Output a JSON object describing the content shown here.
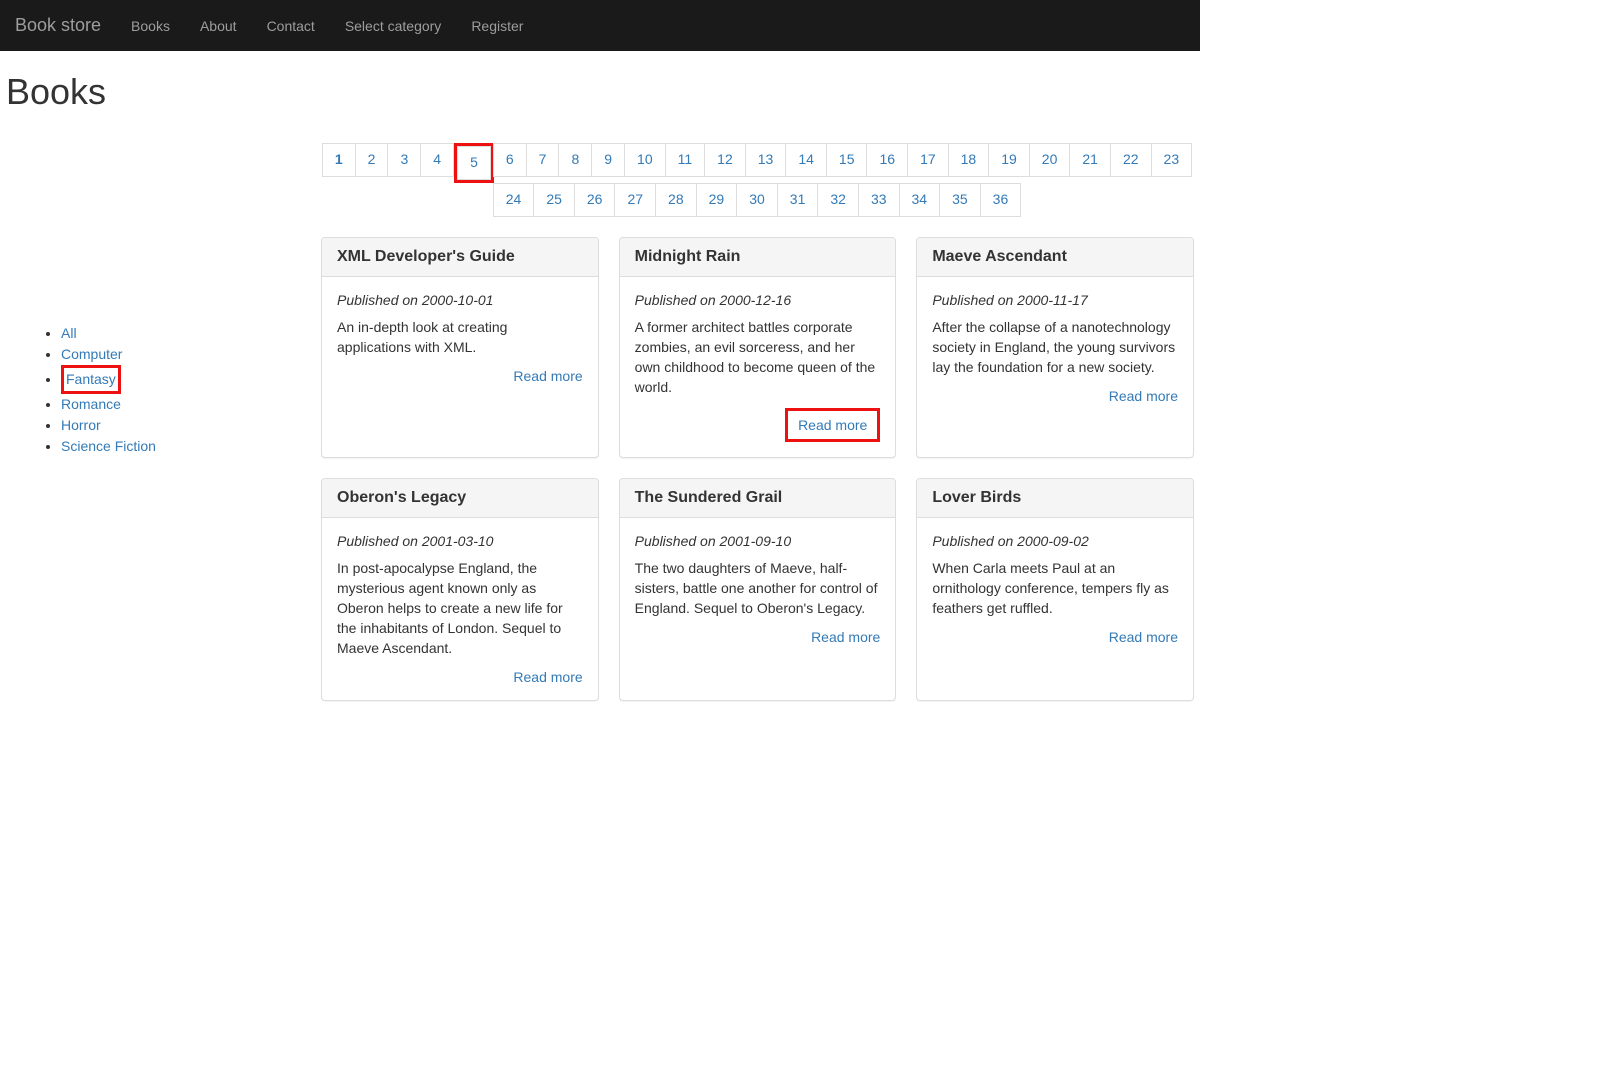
{
  "nav": {
    "brand": "Book store",
    "items": [
      "Books",
      "About",
      "Contact",
      "Select category",
      "Register"
    ]
  },
  "page_title": "Books",
  "pagination": {
    "total": 36,
    "active": 1,
    "highlighted": 5
  },
  "categories": {
    "items": [
      "All",
      "Computer",
      "Fantasy",
      "Romance",
      "Horror",
      "Science Fiction"
    ],
    "highlighted": "Fantasy"
  },
  "read_more_label": "Read more",
  "published_prefix": "Published on ",
  "books": [
    {
      "title": "XML Developer's Guide",
      "date": "2000-10-01",
      "desc": "An in-depth look at creating applications with XML.",
      "hl_readmore": false
    },
    {
      "title": "Midnight Rain",
      "date": "2000-12-16",
      "desc": "A former architect battles corporate zombies, an evil sorceress, and her own childhood to become queen of the world.",
      "hl_readmore": true
    },
    {
      "title": "Maeve Ascendant",
      "date": "2000-11-17",
      "desc": "After the collapse of a nanotechnology society in England, the young survivors lay the foundation for a new society.",
      "hl_readmore": false
    },
    {
      "title": "Oberon's Legacy",
      "date": "2001-03-10",
      "desc": "In post-apocalypse England, the mysterious agent known only as Oberon helps to create a new life for the inhabitants of London. Sequel to Maeve Ascendant.",
      "hl_readmore": false
    },
    {
      "title": "The Sundered Grail",
      "date": "2001-09-10",
      "desc": "The two daughters of Maeve, half-sisters, battle one another for control of England. Sequel to Oberon's Legacy.",
      "hl_readmore": false
    },
    {
      "title": "Lover Birds",
      "date": "2000-09-02",
      "desc": "When Carla meets Paul at an ornithology conference, tempers fly as feathers get ruffled.",
      "hl_readmore": false
    }
  ]
}
